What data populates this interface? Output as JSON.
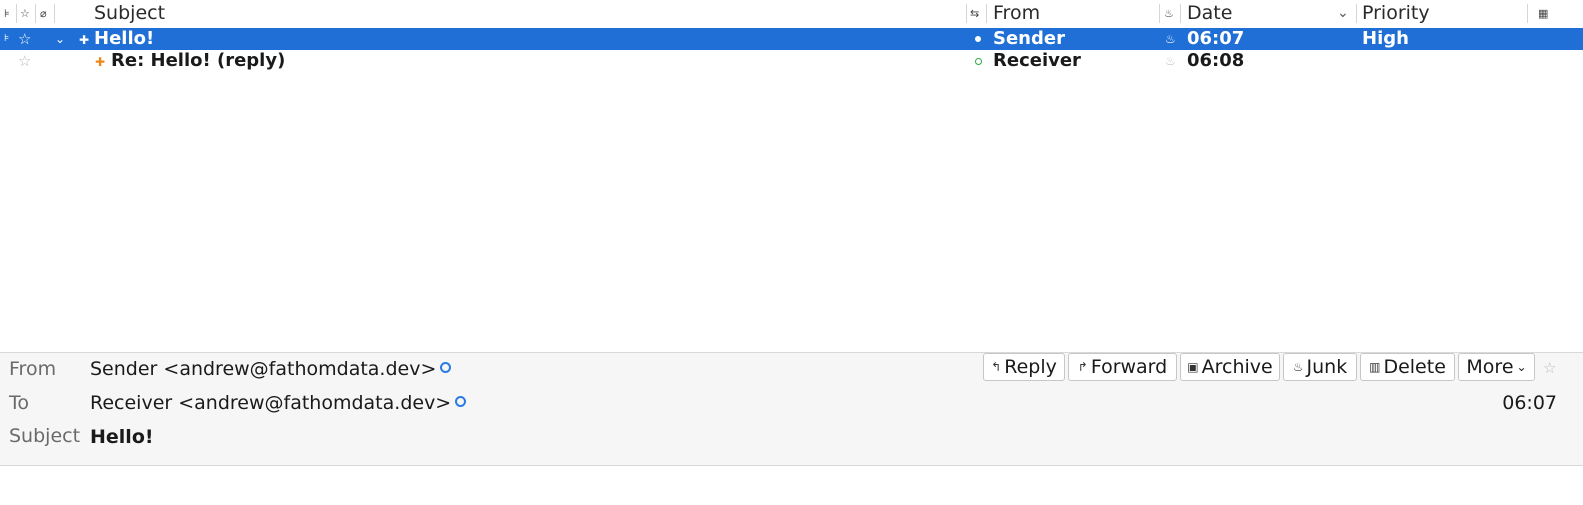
{
  "thread_list": {
    "columns": {
      "subject": "Subject",
      "from": "From",
      "date": "Date",
      "priority": "Priority"
    },
    "rows": [
      {
        "subject": "Hello!",
        "from": "Sender",
        "date": "06:07",
        "priority": "High",
        "selected": true
      },
      {
        "subject": "Re: Hello! (reply)",
        "from": "Receiver",
        "date": "06:08",
        "priority": "",
        "selected": false
      }
    ]
  },
  "message_header": {
    "labels": {
      "from": "From",
      "to": "To",
      "subject": "Subject"
    },
    "from_value": "Sender <andrew@fathomdata.dev>",
    "to_value": "Receiver <andrew@fathomdata.dev>",
    "subject_value": "Hello!",
    "time": "06:07",
    "buttons": {
      "reply": "Reply",
      "forward": "Forward",
      "archive": "Archive",
      "junk": "Junk",
      "delete": "Delete",
      "more": "More"
    }
  },
  "colors": {
    "selection": "#1f6fd6",
    "header_background": "#f6f6f6",
    "reply_icon_orange": "#e8891c",
    "contact_icon_blue": "#2a7be4",
    "online_green": "#2ea84a"
  },
  "icons": [
    "thread-icon",
    "star-icon",
    "attachment-icon",
    "chevron-down-icon",
    "new-message-icon",
    "reply-icon",
    "read-status-icon",
    "junk-flame-icon",
    "column-picker-icon",
    "forward-icon",
    "archive-icon",
    "delete-icon",
    "contact-icon"
  ]
}
